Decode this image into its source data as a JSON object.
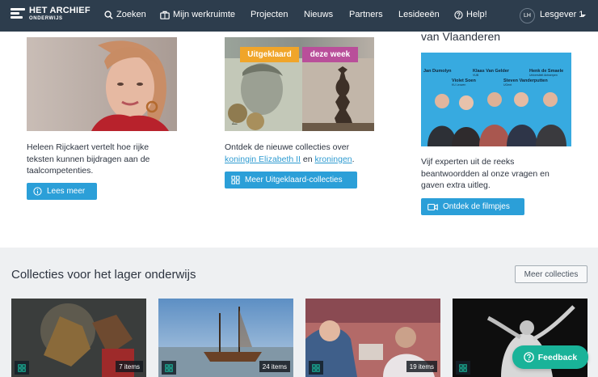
{
  "nav": {
    "logo_title": "HET ARCHIEF",
    "logo_sub": "ONDERWIJS",
    "items": [
      {
        "label": "Zoeken",
        "icon": "search-icon"
      },
      {
        "label": "Mijn werkruimte",
        "icon": "briefcase-icon"
      },
      {
        "label": "Projecten"
      },
      {
        "label": "Nieuws"
      },
      {
        "label": "Partners"
      },
      {
        "label": "Lesideeën"
      },
      {
        "label": "Help!",
        "icon": "help-icon"
      }
    ],
    "user_initials": "LH",
    "user_name": "Lesgever 1"
  },
  "cards": [
    {
      "text": "Heleen Rijckaert vertelt hoe rijke teksten kunnen bijdragen aan de taalcompetenties.",
      "button": "Lees meer",
      "button_icon": "info-icon"
    },
    {
      "tag1": "Uitgeklaard",
      "tag2": "deze week",
      "text_pre": "Ontdek de nieuwe collecties over ",
      "link1": "koningin Elizabeth II",
      "text_mid": " en ",
      "link2": "kroningen",
      "text_post": ".",
      "button": "Meer Uitgeklaard-collecties",
      "button_icon": "grid-icon"
    },
    {
      "title": "van Vlaanderen",
      "people": [
        {
          "name": "Jan Dumolyn"
        },
        {
          "name": "Klaas Van Gelder",
          "role": "VUB"
        },
        {
          "name": "Violet Soen",
          "role": "KU Leuven"
        },
        {
          "name": "Steven Vanderputten",
          "role": "UGent"
        },
        {
          "name": "Henk de Smaele",
          "role": "Universiteit Antwerpen"
        }
      ],
      "text": "Vijf experten uit de reeks beantwoordden al onze vragen en gaven extra uitleg.",
      "button": "Ontdek de filmpjes",
      "button_icon": "video-icon"
    }
  ],
  "section": {
    "title": "Collecties voor het lager onderwijs",
    "more_button": "Meer collecties"
  },
  "collections": [
    {
      "count": "7 items"
    },
    {
      "count": "24 items"
    },
    {
      "count": "19 items"
    },
    {
      "count": ""
    }
  ],
  "feedback": "Feedback",
  "colors": {
    "navbar": "#2d3d4d",
    "accent_blue": "#2b9fd8",
    "tag_orange": "#f0a52a",
    "tag_purple": "#b94f9a",
    "feedback_green": "#19b399"
  }
}
